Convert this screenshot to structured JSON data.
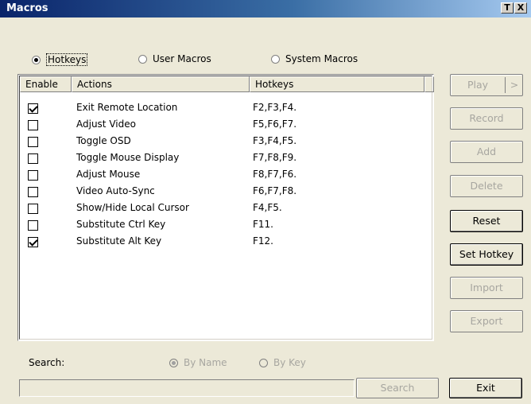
{
  "window": {
    "title": "Macros",
    "help_button": "T",
    "close_button": "X"
  },
  "mode_radios": [
    {
      "label": "Hotkeys",
      "selected": true
    },
    {
      "label": "User Macros",
      "selected": false
    },
    {
      "label": "System Macros",
      "selected": false
    }
  ],
  "table": {
    "columns": [
      "Enable",
      "Actions",
      "Hotkeys"
    ],
    "rows": [
      {
        "enabled": true,
        "action": "Exit Remote Location",
        "hotkeys": "F2,F3,F4."
      },
      {
        "enabled": false,
        "action": "Adjust Video",
        "hotkeys": "F5,F6,F7."
      },
      {
        "enabled": false,
        "action": "Toggle OSD",
        "hotkeys": "F3,F4,F5."
      },
      {
        "enabled": false,
        "action": "Toggle Mouse Display",
        "hotkeys": "F7,F8,F9."
      },
      {
        "enabled": false,
        "action": "Adjust Mouse",
        "hotkeys": "F8,F7,F6."
      },
      {
        "enabled": false,
        "action": "Video Auto-Sync",
        "hotkeys": "F6,F7,F8."
      },
      {
        "enabled": false,
        "action": "Show/Hide Local Cursor",
        "hotkeys": "F4,F5."
      },
      {
        "enabled": false,
        "action": "Substitute Ctrl Key",
        "hotkeys": "F11."
      },
      {
        "enabled": true,
        "action": "Substitute Alt Key",
        "hotkeys": "F12."
      }
    ]
  },
  "side_buttons": {
    "play": "Play",
    "play_arrow": ">",
    "record": "Record",
    "add": "Add",
    "delete": "Delete",
    "reset": "Reset",
    "set_hotkey": "Set Hotkey",
    "import": "Import",
    "export": "Export"
  },
  "search": {
    "label": "Search:",
    "by_name": "By Name",
    "by_key": "By Key",
    "value": "",
    "button": "Search"
  },
  "exit_button": "Exit"
}
